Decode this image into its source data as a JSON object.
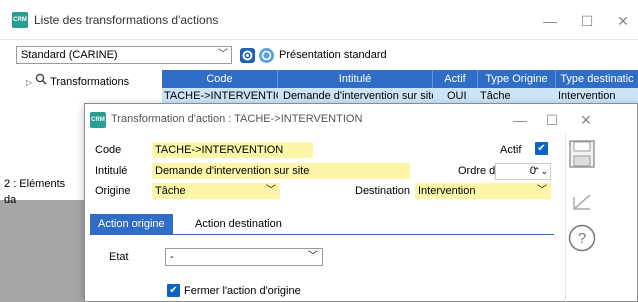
{
  "outer": {
    "title": "Liste des transformations d'actions",
    "app_icon_text": "CRM",
    "toolbar": {
      "combo_value": "Standard (CARINE)",
      "presentation_label": "Présentation standard"
    },
    "tree": {
      "root_label": "Transformations"
    },
    "grid": {
      "columns": [
        "Code",
        "Intitulé",
        "Actif",
        "Type Origine",
        "Type destinatic"
      ],
      "rows": [
        [
          "TACHE->INTERVENTION",
          "Demande d'intervention sur site",
          "OUI",
          "Tâche",
          "Intervention"
        ]
      ]
    },
    "status": "2 : Eléments da"
  },
  "dialog": {
    "title": "Transformation d'action : TACHE->INTERVENTION",
    "fields": {
      "code_label": "Code",
      "code_value": "TACHE->INTERVENTION",
      "actif_label": "Actif",
      "intitule_label": "Intitulé",
      "intitule_value": "Demande d'intervention sur site",
      "ordre_label": "Ordre de tri",
      "ordre_value": "0",
      "origine_label": "Origine",
      "origine_value": "Tâche",
      "destination_label": "Destination",
      "destination_value": "Intervention"
    },
    "tabs": [
      "Action origine",
      "Action destination"
    ],
    "tab_content": {
      "etat_label": "Etat",
      "etat_value": "-",
      "fermer_label": "Fermer l'action d'origine"
    }
  },
  "colors": {
    "accent": "#2f6dc6",
    "selected_row": "#cce4f7",
    "required_field": "#fdf6a8"
  }
}
